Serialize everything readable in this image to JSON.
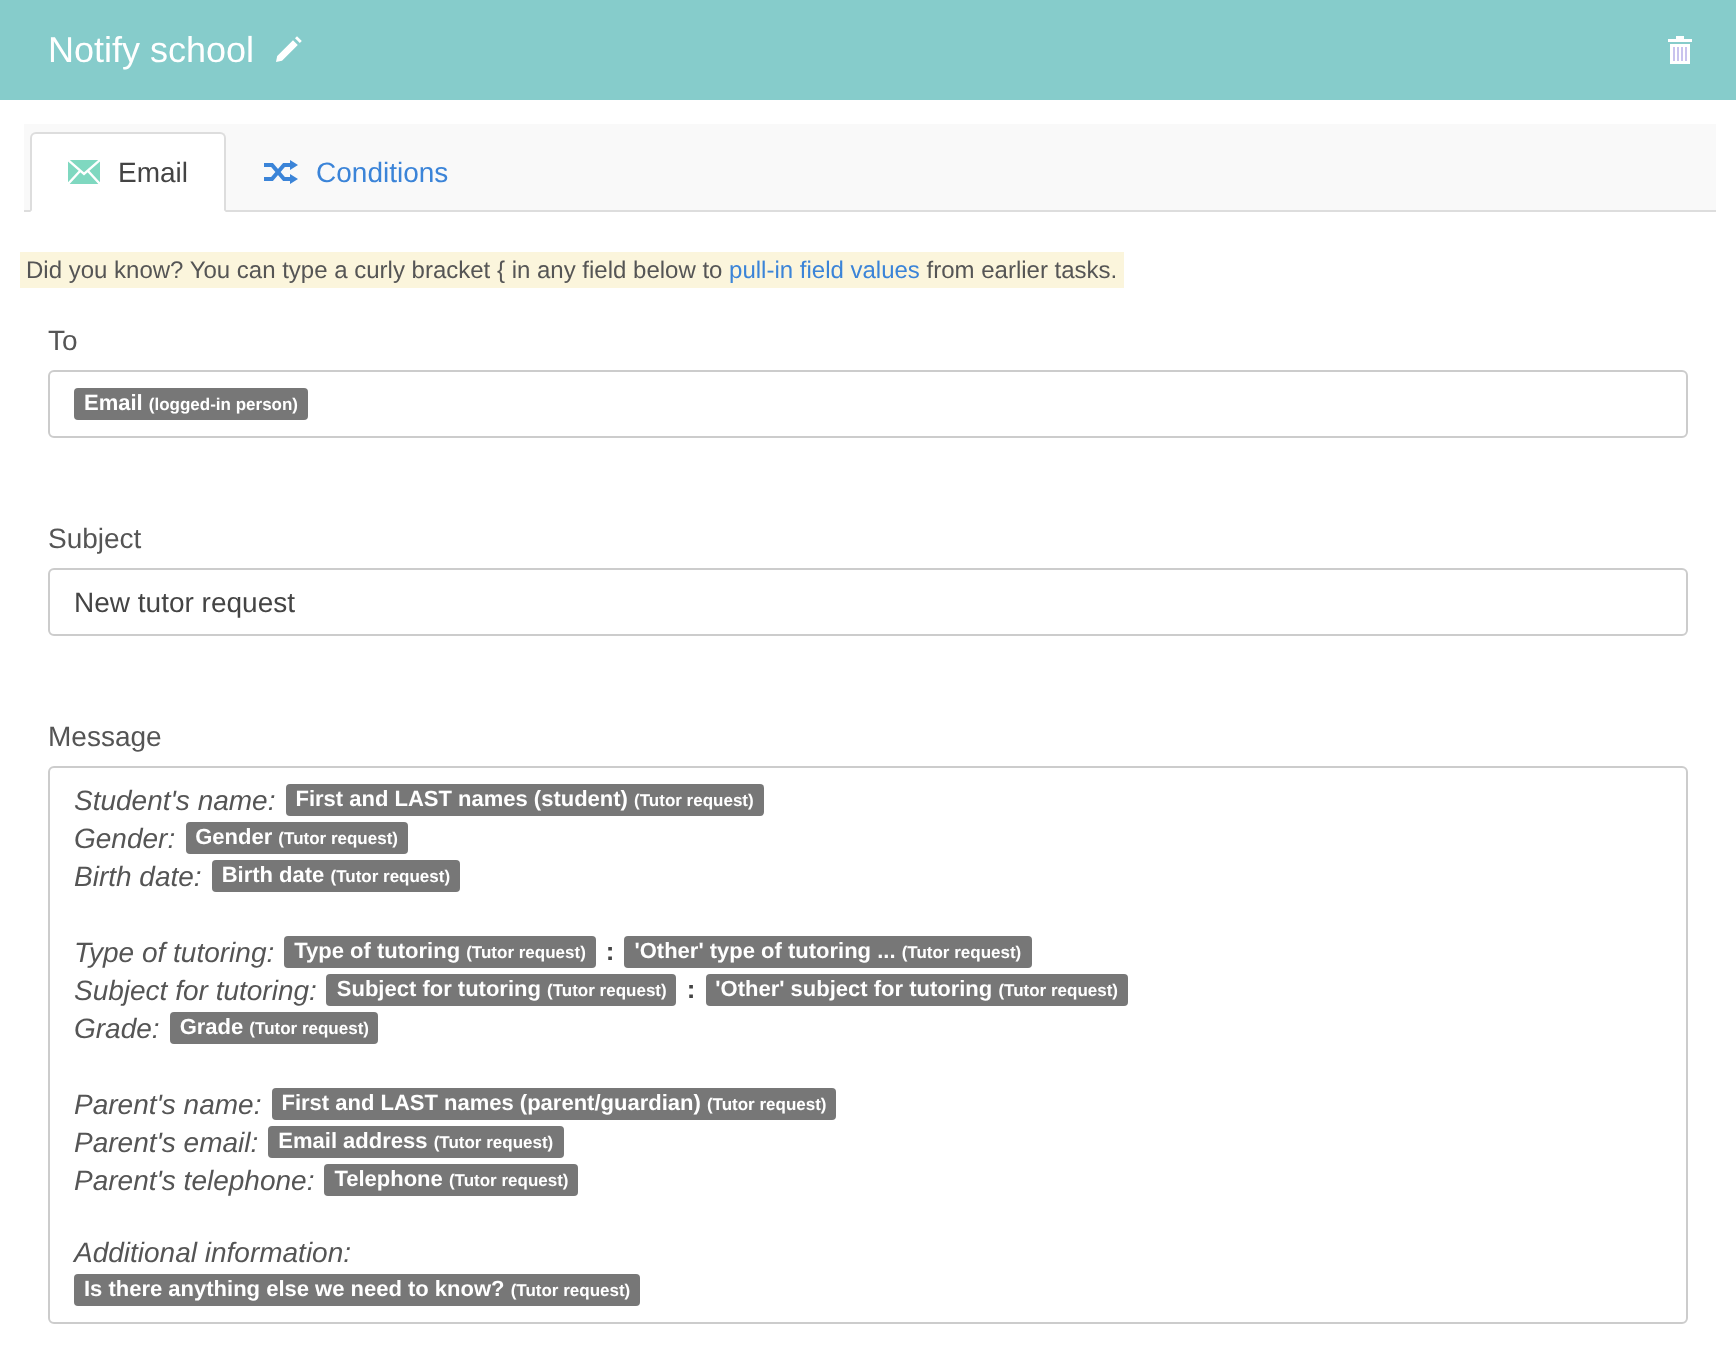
{
  "header": {
    "title": "Notify school"
  },
  "tabs": [
    {
      "label": "Email",
      "selected": true,
      "kind": "email"
    },
    {
      "label": "Conditions",
      "selected": false,
      "kind": "conditions"
    }
  ],
  "hint": {
    "before": "Did you know? You can type a curly bracket { in any field below to ",
    "link": "pull-in field values",
    "after": " from earlier tasks."
  },
  "to": {
    "label": "To",
    "tokens": [
      {
        "name": "Email",
        "source": "(logged-in person)"
      }
    ]
  },
  "subject": {
    "label": "Subject",
    "value": "New tutor request"
  },
  "message": {
    "label": "Message",
    "paragraphs": [
      {
        "lines": [
          {
            "label": "Student's name:",
            "kind": "inline",
            "tokens": [
              {
                "name": "First and LAST names (student)",
                "source": "(Tutor request)"
              }
            ]
          },
          {
            "label": "Gender:",
            "kind": "inline",
            "tokens": [
              {
                "name": "Gender",
                "source": "(Tutor request)"
              }
            ]
          },
          {
            "label": "Birth date:",
            "kind": "inline",
            "tokens": [
              {
                "name": "Birth date",
                "source": "(Tutor request)"
              }
            ]
          }
        ]
      },
      {
        "lines": [
          {
            "label": "Type of tutoring:",
            "kind": "inline",
            "separator": ":",
            "tokens": [
              {
                "name": "Type of tutoring",
                "source": "(Tutor request)"
              },
              {
                "name": "'Other' type of tutoring ...",
                "source": "(Tutor request)"
              }
            ]
          },
          {
            "label": "Subject for tutoring:",
            "kind": "inline",
            "separator": ":",
            "tokens": [
              {
                "name": "Subject for tutoring",
                "source": "(Tutor request)"
              },
              {
                "name": "'Other' subject for tutoring",
                "source": "(Tutor request)"
              }
            ]
          },
          {
            "label": "Grade:",
            "kind": "inline",
            "tokens": [
              {
                "name": "Grade",
                "source": "(Tutor request)"
              }
            ]
          }
        ]
      },
      {
        "lines": [
          {
            "label": "Parent's name:",
            "kind": "inline",
            "tokens": [
              {
                "name": "First and LAST names (parent/guardian)",
                "source": "(Tutor request)"
              }
            ]
          },
          {
            "label": "Parent's email:",
            "kind": "inline",
            "tokens": [
              {
                "name": "Email address",
                "source": "(Tutor request)"
              }
            ]
          },
          {
            "label": "Parent's telephone:",
            "kind": "inline",
            "tokens": [
              {
                "name": "Telephone",
                "source": "(Tutor request)"
              }
            ]
          }
        ]
      },
      {
        "lines": [
          {
            "label": "Additional information:",
            "kind": "block",
            "tokens": [
              {
                "name": "Is there anything else we need to know?",
                "source": "(Tutor request)"
              }
            ]
          }
        ]
      }
    ]
  }
}
